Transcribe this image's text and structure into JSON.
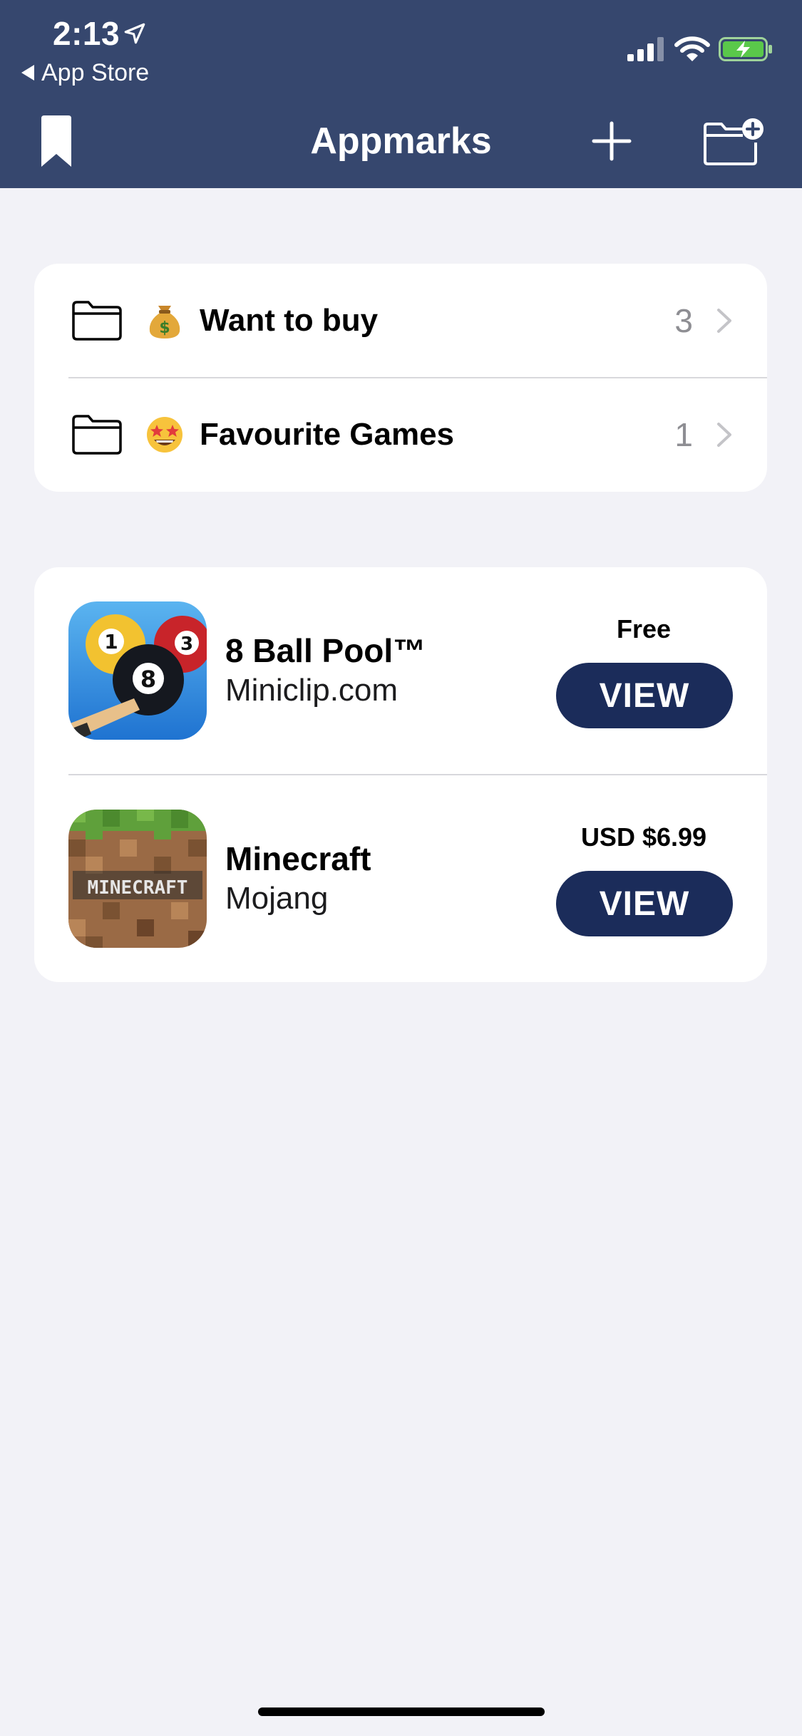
{
  "status_bar": {
    "time": "2:13",
    "back_app": "App Store",
    "icons": [
      "location-arrow-icon",
      "cellular-signal-icon",
      "wifi-icon",
      "battery-charging-icon"
    ]
  },
  "nav": {
    "title": "Appmarks",
    "left_icon": "bookmark-icon",
    "right_icons": [
      "plus-icon",
      "new-folder-icon"
    ]
  },
  "folders": [
    {
      "emoji": "money-bag-emoji",
      "name": "Want to buy",
      "count": "3"
    },
    {
      "emoji": "star-struck-emoji",
      "name": "Favourite Games",
      "count": "1"
    }
  ],
  "apps": [
    {
      "name": "8 Ball Pool™",
      "developer": "Miniclip.com",
      "price": "Free",
      "button": "VIEW",
      "icon": "8-ball-pool-app-icon"
    },
    {
      "name": "Minecraft",
      "developer": "Mojang",
      "price": "USD $6.99",
      "button": "VIEW",
      "icon": "minecraft-app-icon",
      "icon_text": "MINECRAFT"
    }
  ],
  "colors": {
    "header": "#36476e",
    "view_button": "#1b2c5a",
    "background": "#f2f2f7",
    "battery": "#5ac84a"
  }
}
